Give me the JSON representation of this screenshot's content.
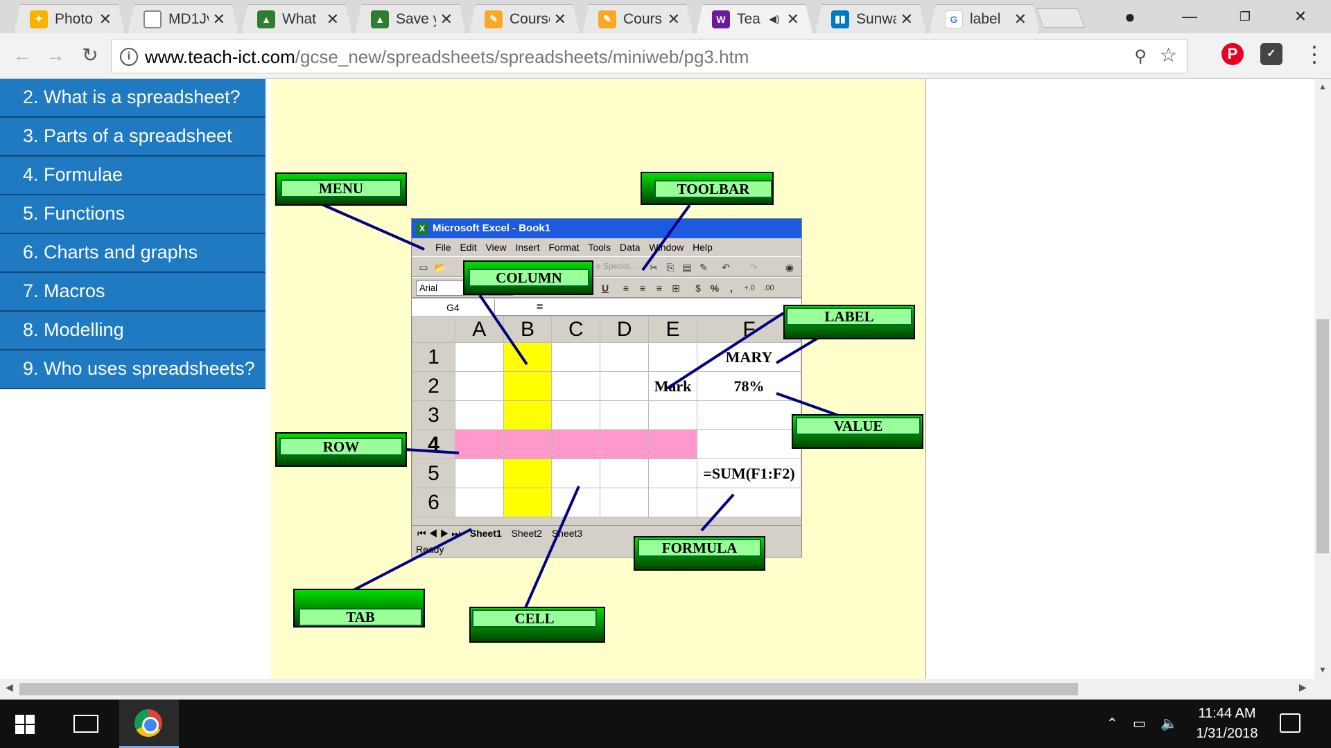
{
  "browser": {
    "tabs": [
      {
        "title": "Photo",
        "favicon": "photos-icon",
        "color": "#f4b400"
      },
      {
        "title": "MD1Jv",
        "favicon": "document-icon",
        "color": "#888888"
      },
      {
        "title": "What",
        "favicon": "classroom-icon",
        "color": "#2e7d32"
      },
      {
        "title": "Save y",
        "favicon": "classroom-icon",
        "color": "#2e7d32"
      },
      {
        "title": "Course",
        "favicon": "pencil-icon",
        "color": "#f9a825"
      },
      {
        "title": "Cours",
        "favicon": "pencil-icon",
        "color": "#f9a825"
      },
      {
        "title": "Tea",
        "favicon": "logo-icon",
        "color": "#6a1b9a",
        "active": true,
        "audio": true
      },
      {
        "title": "Sunwa",
        "favicon": "trello-icon",
        "color": "#0079bf"
      },
      {
        "title": "label",
        "favicon": "google-icon",
        "color": "#4285f4"
      }
    ],
    "url_host": "www.teach-ict.com",
    "url_path": "/gcse_new/spreadsheets/spreadsheets/miniweb/pg3.htm"
  },
  "sidebar": {
    "items": [
      {
        "label": "2. What is a spreadsheet?"
      },
      {
        "label": "3. Parts of a spreadsheet"
      },
      {
        "label": "4. Formulae"
      },
      {
        "label": "5. Functions"
      },
      {
        "label": "6. Charts and graphs"
      },
      {
        "label": "7. Macros"
      },
      {
        "label": "8. Modelling"
      },
      {
        "label": "9. Who uses spreadsheets?"
      }
    ]
  },
  "excel": {
    "title": "Microsoft Excel - Book1",
    "menu": [
      "File",
      "Edit",
      "View",
      "Insert",
      "Format",
      "Tools",
      "Data",
      "Window",
      "Help"
    ],
    "font": "Arial",
    "namebox": "G4",
    "eq": "=",
    "paste_special": "e Special...",
    "columns": [
      "A",
      "B",
      "C",
      "D",
      "E",
      "F"
    ],
    "rows": [
      "1",
      "2",
      "3",
      "4",
      "5",
      "6"
    ],
    "cells": {
      "F1": "MARY",
      "E2": "Mark",
      "F2": "78%",
      "F5": "=SUM(F1:F2)"
    },
    "sheets": [
      "Sheet1",
      "Sheet2",
      "Sheet3"
    ],
    "status": "Ready"
  },
  "labels": {
    "menu": "MENU",
    "toolbar": "TOOLBAR",
    "column": "COLUMN",
    "label": "LABEL",
    "value": "VALUE",
    "row": "ROW",
    "formula": "FORMULA",
    "tab": "TAB",
    "cell": "CELL"
  },
  "taskbar": {
    "time": "11:44 AM",
    "date": "1/31/2018"
  }
}
